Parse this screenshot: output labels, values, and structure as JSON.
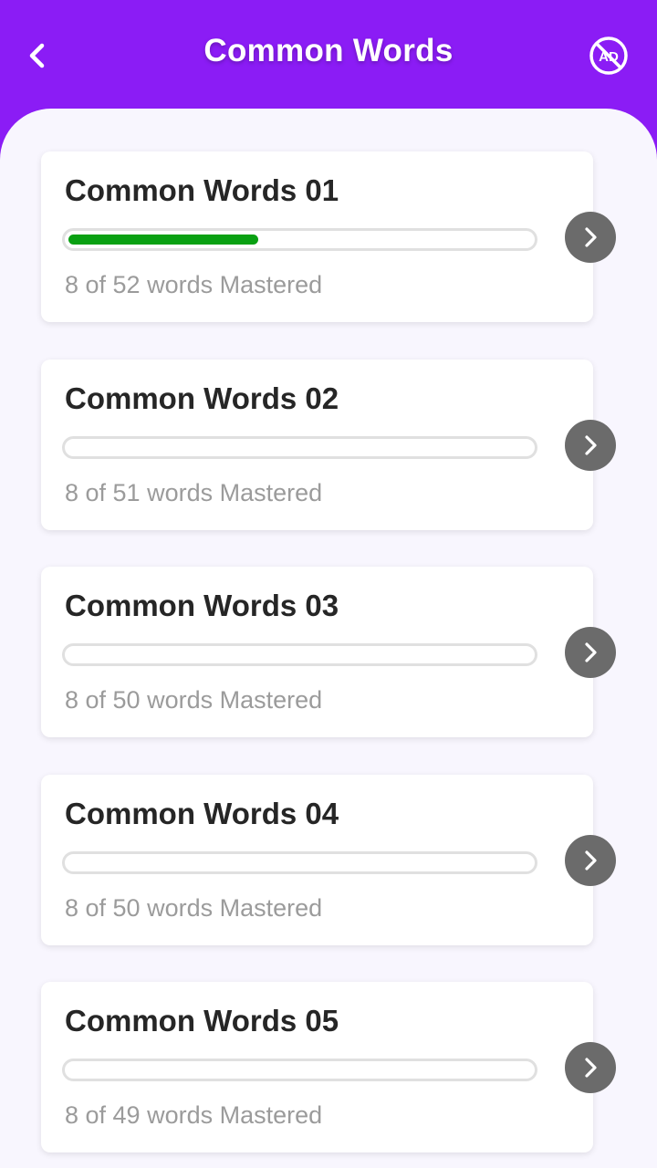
{
  "header": {
    "title": "Common Words",
    "back_icon": "chevron-left-icon",
    "noads_icon": "no-ads-icon",
    "noads_icon_text": "AD"
  },
  "colors": {
    "header_bg": "#8b1cf5",
    "content_bg": "#f8f6fe",
    "progress_fill": "#09a012",
    "progress_track": "#e0e0e0",
    "arrow_button_bg": "#6b6b6b"
  },
  "lessons": [
    {
      "title": "Common Words 01",
      "status": "8 of 52 words Mastered",
      "progress": 0.41
    },
    {
      "title": "Common Words 02",
      "status": "8 of 51 words Mastered",
      "progress": 0
    },
    {
      "title": "Common Words 03",
      "status": "8 of 50 words Mastered",
      "progress": 0
    },
    {
      "title": "Common Words 04",
      "status": "8 of 50 words Mastered",
      "progress": 0
    },
    {
      "title": "Common Words 05",
      "status": "8 of 49 words Mastered",
      "progress": 0
    }
  ]
}
